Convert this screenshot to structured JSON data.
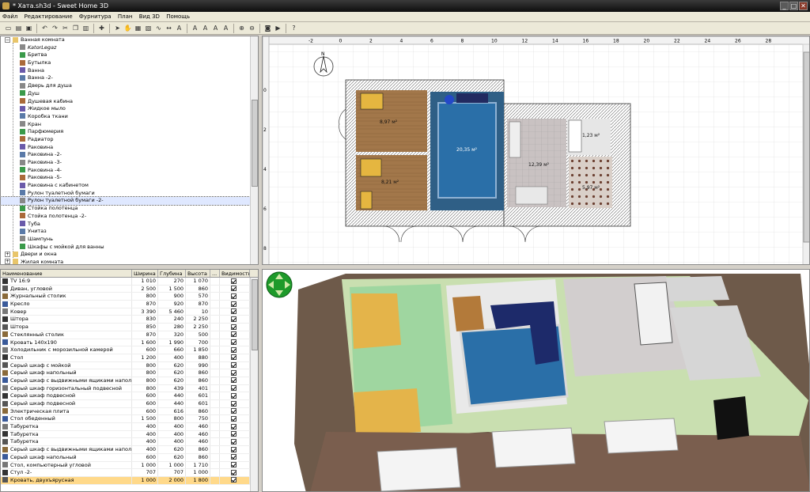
{
  "window": {
    "title": "* Хата.sh3d - Sweet Home 3D",
    "min": "_",
    "max": "□",
    "close": "✕"
  },
  "menu": [
    "Файл",
    "Редактирование",
    "Фурнитура",
    "План",
    "Вид 3D",
    "Помощь"
  ],
  "toolbar_icons": [
    "new-icon",
    "open-icon",
    "save-icon",
    "sep",
    "undo-icon",
    "redo-icon",
    "cut-icon",
    "copy-icon",
    "paste-icon",
    "sep",
    "add-furniture-icon",
    "sep",
    "select-icon",
    "pan-icon",
    "create-walls-icon",
    "create-rooms-icon",
    "create-polylines-icon",
    "create-dimensions-icon",
    "add-text-icon",
    "sep",
    "text-style-icons",
    "text-style-icons",
    "text-style-icons",
    "text-style-icons",
    "sep",
    "zoom-in-icon",
    "zoom-out-icon",
    "sep",
    "create-photo-icon",
    "create-video-icon",
    "sep",
    "help-icon"
  ],
  "catalog": {
    "items": [
      {
        "label": "Ванная комната",
        "level": 0,
        "folder": true
      },
      {
        "label": "KatorLegaz",
        "level": 1,
        "italic": true
      },
      {
        "label": "Бритва",
        "level": 1
      },
      {
        "label": "Бутылка",
        "level": 1
      },
      {
        "label": "Ванна",
        "level": 1
      },
      {
        "label": "Ванна -2-",
        "level": 1
      },
      {
        "label": "Дверь для душа",
        "level": 1
      },
      {
        "label": "Душ",
        "level": 1
      },
      {
        "label": "Душевая кабина",
        "level": 1
      },
      {
        "label": "Жидкое мыло",
        "level": 1
      },
      {
        "label": "Коробка ткани",
        "level": 1
      },
      {
        "label": "Кран",
        "level": 1
      },
      {
        "label": "Парфюмерия",
        "level": 1
      },
      {
        "label": "Радиатор",
        "level": 1
      },
      {
        "label": "Раковина",
        "level": 1
      },
      {
        "label": "Раковина -2-",
        "level": 1
      },
      {
        "label": "Раковина -3-",
        "level": 1
      },
      {
        "label": "Раковина -4-",
        "level": 1
      },
      {
        "label": "Раковина -5-",
        "level": 1
      },
      {
        "label": "Раковина с кабинетом",
        "level": 1
      },
      {
        "label": "Рулон туалетной бумаги",
        "level": 1
      },
      {
        "label": "Рулон туалетной бумаги -2-",
        "level": 1,
        "selected": true
      },
      {
        "label": "Стойка полотенца",
        "level": 1
      },
      {
        "label": "Стойка полотенца -2-",
        "level": 1
      },
      {
        "label": "Туба",
        "level": 1
      },
      {
        "label": "Унитаз",
        "level": 1
      },
      {
        "label": "Шампунь",
        "level": 1
      },
      {
        "label": "Шкафы с мойкой для ванны",
        "level": 1
      },
      {
        "label": "Двери и окна",
        "level": 0,
        "folder": true
      },
      {
        "label": "Жилая комната",
        "level": 0,
        "folder": true
      }
    ]
  },
  "furniture_table": {
    "columns": [
      "Наименование",
      "Ширина",
      "Глубина",
      "Высота",
      "...",
      "Видимость"
    ],
    "rows": [
      [
        "TV 16:9",
        "1 010",
        "270",
        "1 070"
      ],
      [
        "Диван, угловой",
        "2 500",
        "1 500",
        "860"
      ],
      [
        "Журнальный столик",
        "800",
        "900",
        "570"
      ],
      [
        "Кресло",
        "870",
        "920",
        "870"
      ],
      [
        "Ковер",
        "3 390",
        "5 460",
        "10"
      ],
      [
        "Штора",
        "830",
        "240",
        "2 250"
      ],
      [
        "Штора",
        "850",
        "280",
        "2 250"
      ],
      [
        "Стеклянный столик",
        "870",
        "320",
        "500"
      ],
      [
        "Кровать 140x190",
        "1 600",
        "1 990",
        "700"
      ],
      [
        "Холодильник с морозильной камерой",
        "600",
        "660",
        "1 850"
      ],
      [
        "Стол",
        "1 200",
        "400",
        "880"
      ],
      [
        "Серый шкаф с мойкой",
        "800",
        "620",
        "990"
      ],
      [
        "Серый шкаф напольный",
        "800",
        "620",
        "860"
      ],
      [
        "Серый шкаф с выдвижными ящиками наполь...",
        "800",
        "620",
        "860"
      ],
      [
        "Серый шкаф горизонтальный подвесной",
        "800",
        "439",
        "401"
      ],
      [
        "Серый шкаф подвесной",
        "600",
        "440",
        "601"
      ],
      [
        "Серый шкаф подвесной",
        "600",
        "440",
        "601"
      ],
      [
        "Электрическая плита",
        "600",
        "616",
        "860"
      ],
      [
        "Стол обеденный",
        "1 500",
        "800",
        "750"
      ],
      [
        "Табуретка",
        "400",
        "400",
        "460"
      ],
      [
        "Табуретка",
        "400",
        "400",
        "460"
      ],
      [
        "Табуретка",
        "400",
        "400",
        "460"
      ],
      [
        "Серый шкаф с выдвижными ящиками наполь...",
        "400",
        "620",
        "860"
      ],
      [
        "Серый шкаф напольный",
        "600",
        "620",
        "860"
      ],
      [
        "Стол, компьютерный угловой",
        "1 000",
        "1 000",
        "1 710"
      ],
      [
        "Стул -2-",
        "707",
        "707",
        "1 000"
      ],
      [
        "Кровать, двухъярусная",
        "1 000",
        "2 000",
        "1 800"
      ]
    ],
    "selected_row": 26
  },
  "plan": {
    "ruler_x": [
      "-2",
      "0",
      "2",
      "4",
      "6",
      "8",
      "10",
      "12",
      "14",
      "16",
      "18",
      "20",
      "22",
      "24",
      "26",
      "28"
    ],
    "ruler_y": [
      "0",
      "2",
      "4",
      "6",
      "8"
    ],
    "north_label": "N",
    "room_areas": [
      "8,97 м²",
      "20,35 м²",
      "12,39 м²",
      "1,23 м²",
      "8,21 м²",
      "5,97 м²"
    ]
  },
  "colors": {
    "wall": "#6e5a4a",
    "brown_room": "#a2774a",
    "carpet": "#2a6fa8",
    "tile": "#c9c2c2",
    "title_bg": "#1c1c1c"
  }
}
